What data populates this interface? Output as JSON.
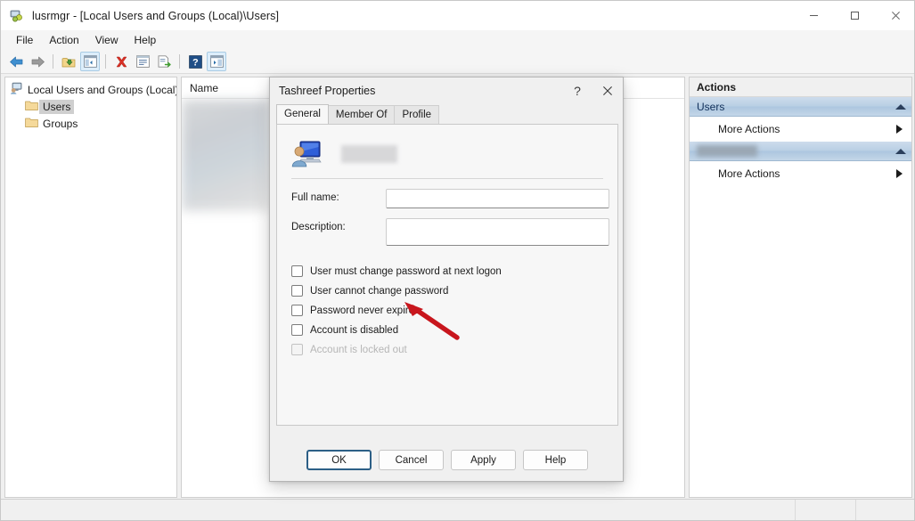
{
  "window": {
    "title": "lusrmgr - [Local Users and Groups (Local)\\Users]",
    "icon": "mmc-snapin-icon",
    "controls": {
      "minimize": "minimize-icon",
      "maximize": "maximize-icon",
      "close": "close-icon"
    }
  },
  "menubar": {
    "items": [
      {
        "label": "File"
      },
      {
        "label": "Action"
      },
      {
        "label": "View"
      },
      {
        "label": "Help"
      }
    ]
  },
  "toolbar": {
    "buttons": [
      {
        "name": "back-icon",
        "tip": "Back"
      },
      {
        "name": "forward-icon",
        "tip": "Forward"
      },
      {
        "name": "up-one-level-icon",
        "tip": "Up One Level"
      },
      {
        "name": "show-hide-console-tree-icon",
        "tip": "Show/Hide Console Tree"
      },
      {
        "name": "delete-icon",
        "tip": "Delete"
      },
      {
        "name": "properties-icon",
        "tip": "Properties"
      },
      {
        "name": "export-list-icon",
        "tip": "Export List"
      },
      {
        "name": "help-icon",
        "tip": "Help"
      },
      {
        "name": "show-hide-action-pane-icon",
        "tip": "Show/Hide Action Pane"
      }
    ]
  },
  "tree": {
    "root": {
      "label": "Local Users and Groups (Local)",
      "icon": "computer-icon"
    },
    "children": [
      {
        "label": "Users",
        "icon": "folder-icon",
        "selected": true
      },
      {
        "label": "Groups",
        "icon": "folder-icon",
        "selected": false
      }
    ]
  },
  "list": {
    "columns": [
      {
        "label": "Name"
      }
    ],
    "rows": [],
    "redacted": true
  },
  "actions": {
    "title": "Actions",
    "groups": [
      {
        "header": "Users",
        "header_redacted": false,
        "collapse_icon": "chevron-up-icon",
        "items": [
          {
            "label": "More Actions",
            "submenu_icon": "chevron-right-icon"
          }
        ]
      },
      {
        "header": "",
        "header_redacted": true,
        "collapse_icon": "chevron-up-icon",
        "items": [
          {
            "label": "More Actions",
            "submenu_icon": "chevron-right-icon"
          }
        ]
      }
    ]
  },
  "dialog": {
    "title": "Tashreef Properties",
    "help_button": "?",
    "close_button": "close-icon",
    "tabs": [
      {
        "label": "General",
        "active": true
      },
      {
        "label": "Member Of",
        "active": false
      },
      {
        "label": "Profile",
        "active": false
      }
    ],
    "identity": {
      "icon": "user-account-icon",
      "username_redacted": true,
      "username": ""
    },
    "fields": [
      {
        "label": "Full name:",
        "value": "",
        "placeholder": "",
        "multiline": false
      },
      {
        "label": "Description:",
        "value": "",
        "placeholder": "",
        "multiline": true
      }
    ],
    "checkboxes": [
      {
        "label": "User must change password at next logon",
        "checked": false,
        "disabled": false
      },
      {
        "label": "User cannot change password",
        "checked": false,
        "disabled": false
      },
      {
        "label": "Password never expires",
        "checked": false,
        "disabled": false
      },
      {
        "label": "Account is disabled",
        "checked": false,
        "disabled": false
      },
      {
        "label": "Account is locked out",
        "checked": false,
        "disabled": true
      }
    ],
    "buttons": [
      {
        "label": "OK",
        "default": true
      },
      {
        "label": "Cancel",
        "default": false
      },
      {
        "label": "Apply",
        "default": false
      },
      {
        "label": "Help",
        "default": false
      }
    ]
  },
  "annotation": {
    "type": "arrow",
    "color": "#c8161d",
    "points_to": "Password never expires"
  },
  "statusbar": {
    "text": ""
  },
  "colors": {
    "accent": "#2c5f86",
    "actions_header": "#b9cfe4",
    "annotation_red": "#c8161d",
    "window_bg": "#f0f0f0"
  }
}
